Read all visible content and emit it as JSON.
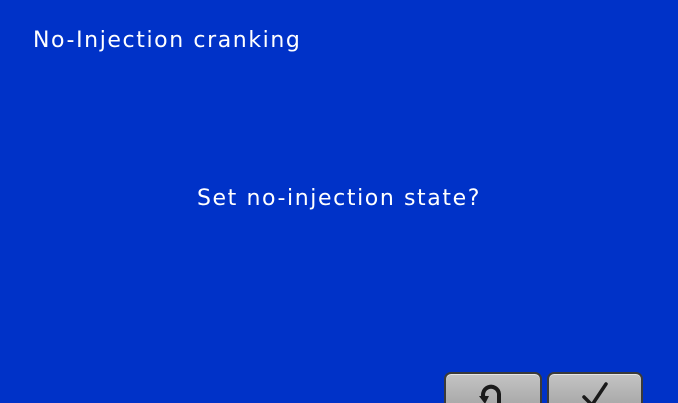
{
  "screen": {
    "title": "No-Injection cranking",
    "prompt": "Set no-injection state?",
    "background_color": "#0032C8",
    "text_color": "#FFFFFF"
  },
  "buttons": {
    "back": {
      "icon": "return-arrow-icon"
    },
    "confirm": {
      "icon": "checkmark-icon"
    }
  }
}
